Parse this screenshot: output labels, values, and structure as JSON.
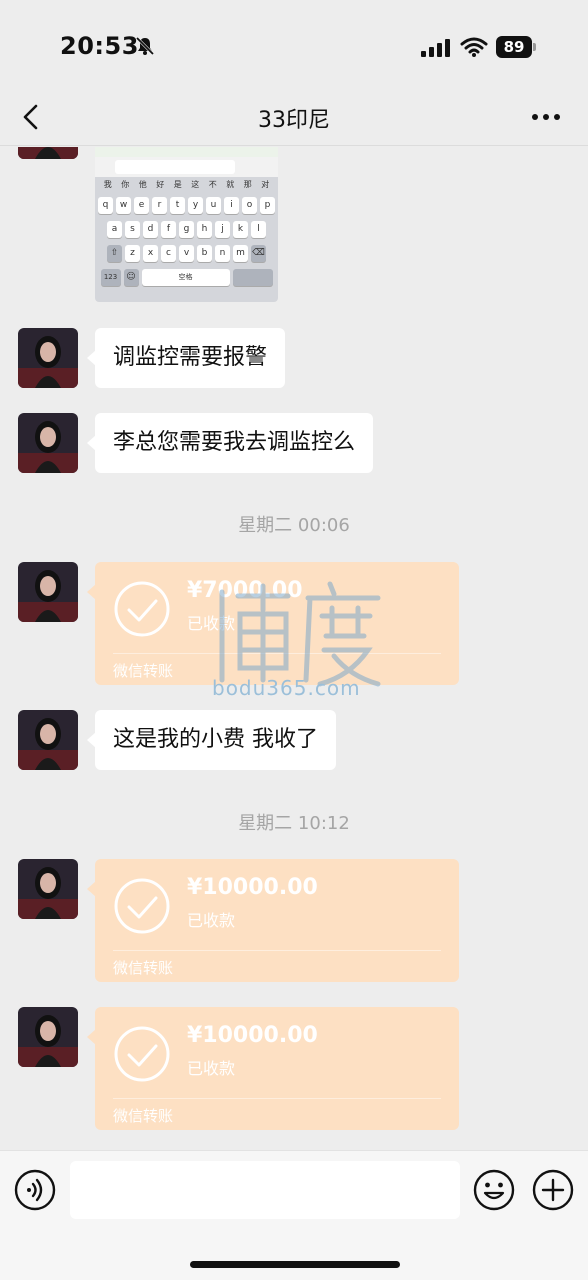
{
  "status_bar": {
    "time": "20:53",
    "battery": "89"
  },
  "nav": {
    "title": "33印尼"
  },
  "keyboard_image": {
    "candidates": [
      "我",
      "你",
      "他",
      "好",
      "是",
      "这",
      "不",
      "就",
      "那",
      "对"
    ],
    "row1": [
      "q",
      "w",
      "e",
      "r",
      "t",
      "y",
      "u",
      "i",
      "o",
      "p"
    ],
    "row2": [
      "a",
      "s",
      "d",
      "f",
      "g",
      "h",
      "j",
      "k",
      "l"
    ],
    "row3": [
      "z",
      "x",
      "c",
      "v",
      "b",
      "n",
      "m"
    ],
    "num_key": "123",
    "space_key": "空格"
  },
  "messages": {
    "m1": "调监控需要报警",
    "m2": "李总您需要我去调监控么",
    "ts1": "星期二 00:06",
    "t1": {
      "amount": "¥7000.00",
      "status": "已收款",
      "footer": "微信转账"
    },
    "m3": "这是我的小费 我收了",
    "ts2": "星期二 10:12",
    "t2": {
      "amount": "¥10000.00",
      "status": "已收款",
      "footer": "微信转账"
    },
    "t3": {
      "amount": "¥10000.00",
      "status": "已收款",
      "footer": "微信转账"
    }
  },
  "watermark": {
    "text": "bodu365.com"
  },
  "colors": {
    "transfer_bg": "#fde0c3",
    "chat_bg": "#ededed"
  }
}
